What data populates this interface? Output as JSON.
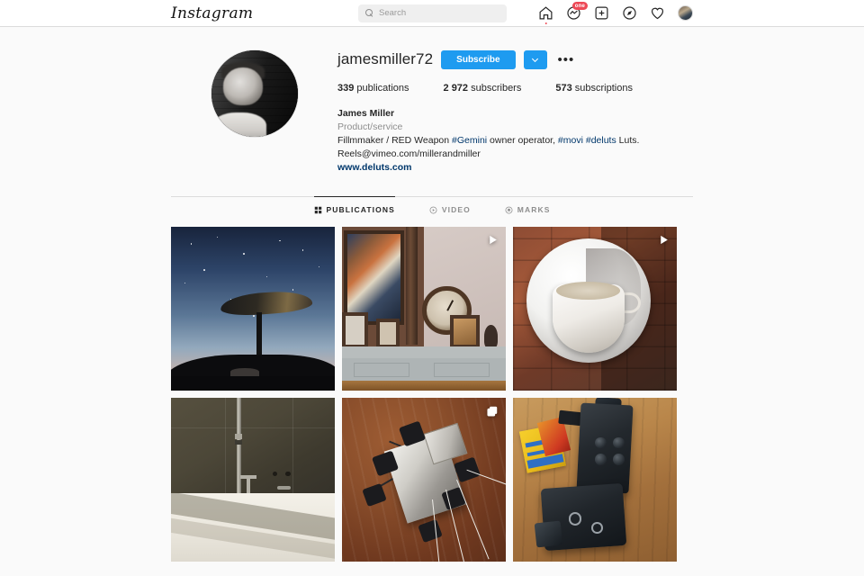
{
  "nav": {
    "brand": "Instagram",
    "search_placeholder": "Search",
    "icons": [
      {
        "name": "home-icon",
        "label": "Home"
      },
      {
        "name": "messenger-icon",
        "label": "Messenger",
        "badge": "one"
      },
      {
        "name": "add-post-icon",
        "label": "New post"
      },
      {
        "name": "explore-icon",
        "label": "Explore"
      },
      {
        "name": "activity-heart-icon",
        "label": "Activity"
      },
      {
        "name": "profile-avatar-icon",
        "label": "Profile"
      }
    ]
  },
  "profile": {
    "username": "jamesmiller72",
    "subscribe_label": "Subscribe",
    "caret_label": "",
    "more_label": "•••",
    "stats": [
      {
        "value": "339",
        "label": "publications"
      },
      {
        "value": "2 972",
        "label": "subscribers"
      },
      {
        "value": "573",
        "label": "subscriptions"
      }
    ],
    "full_name": "James Miller",
    "category": "Product/service",
    "bio_line1_a": "Fillmmaker / RED Weapon ",
    "bio_tag1": "#Gemini",
    "bio_line1_b": " owner operator, ",
    "bio_tag2": "#movi",
    "bio_line1_c": " ",
    "bio_tag3": "#deluts",
    "bio_line1_d": " Luts.",
    "bio_email": "Reels@vimeo.com/millerandmiller",
    "bio_website": "www.deluts.com"
  },
  "tabs": [
    {
      "label": "PUBLICATIONS",
      "icon": "grid-icon",
      "active": true
    },
    {
      "label": "VIDEO",
      "icon": "play-circle-icon",
      "active": false
    },
    {
      "label": "MARKS",
      "icon": "tag-circle-icon",
      "active": false
    }
  ],
  "grid": {
    "posts": [
      {
        "id": "post-1",
        "alt": "Satellite dish silhouetted against twilight sky with stars",
        "overlay": "none"
      },
      {
        "id": "post-2",
        "alt": "Mantelpiece with framed pictures and round wall clock",
        "overlay": "video"
      },
      {
        "id": "post-3",
        "alt": "White teacup and saucer on red brick",
        "overlay": "video"
      },
      {
        "id": "post-4",
        "alt": "Concrete wall with pipe and tap above pale floor",
        "overlay": "none"
      },
      {
        "id": "post-5",
        "alt": "Mars rover descending over rust-colored terrain",
        "overlay": "carousel"
      },
      {
        "id": "post-6",
        "alt": "Two vintage Super-8 film cameras with Kodak film boxes on wood",
        "overlay": "none"
      }
    ]
  },
  "colors": {
    "accent_blue": "#1e9bf0",
    "link_blue": "#00376b",
    "badge_red": "#ed4956",
    "page_bg": "#fafafa",
    "text": "#262626",
    "muted": "#8e8e8e"
  }
}
